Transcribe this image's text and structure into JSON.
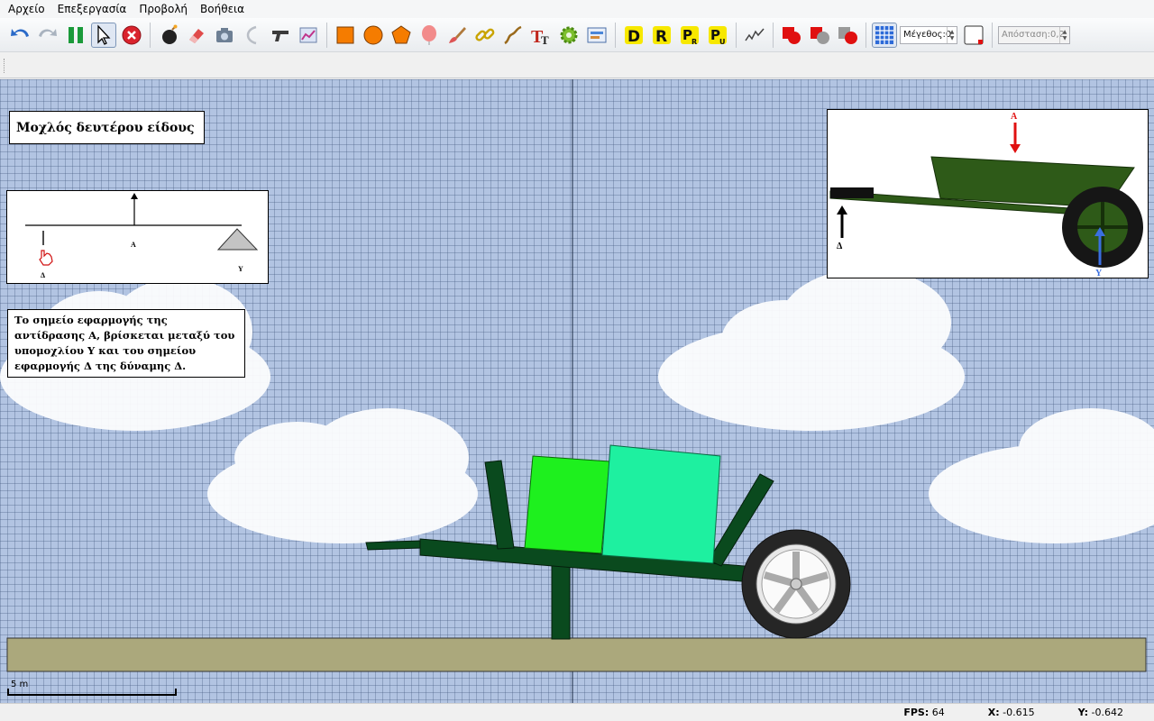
{
  "menu": [
    "Αρχείο",
    "Επεξεργασία",
    "Προβολή",
    "Βοήθεια"
  ],
  "toolbar": {
    "size_field": "Μέγεθος:0",
    "distance_field": "Απόσταση:0,2"
  },
  "icons": {
    "undo": "undo-icon",
    "redo": "redo-icon",
    "pause": "pause-icon",
    "pointer": "pointer-icon",
    "delete": "delete-icon",
    "bomb": "bomb-icon",
    "eraser": "eraser-icon",
    "camera": "camera-icon",
    "rope": "rope-icon",
    "gun": "gun-icon",
    "graph": "graph-icon",
    "box": "box-icon",
    "circle": "circle-icon",
    "polygon": "polygon-icon",
    "balloon": "balloon-icon",
    "brush": "brush-icon",
    "chain": "chain-icon",
    "spring": "spring-icon",
    "text": "text-icon",
    "gear": "gear-icon",
    "image": "image-icon",
    "joint_d": "joint-d-icon",
    "joint_r": "joint-r-icon",
    "joint_pr": "joint-pr-icon",
    "joint_pu": "joint-pu-icon",
    "zigzag": "zigzag-icon",
    "collide_a": "collide-a-icon",
    "collide_b": "collide-b-icon",
    "collide_c": "collide-c-icon",
    "grid": "grid-icon",
    "color": "color-swatch-icon"
  },
  "scene": {
    "title": "Μοχλός δευτέρου είδους",
    "note": "Το σημείο εφαρμογής της αντίδρασης Α, βρίσκεται μεταξύ του υπομοχλίου Υ και του σημείου εφαρμογής Δ της δύναμης Δ.",
    "lever_labels": {
      "delta": "Δ",
      "alpha": "Α",
      "ypsilon": "Υ"
    },
    "photo_labels": {
      "alpha": "Α",
      "delta": "Δ",
      "ypsilon": "Υ"
    },
    "scale_label": "5 m",
    "colors": {
      "frame": "#0a4a1e",
      "box_a": "#1ef01e",
      "box_b": "#1ef0a0",
      "ground": "#aba87c",
      "sky": "#b2c4e2"
    }
  },
  "status": {
    "fps_label": "FPS:",
    "fps_value": "64",
    "x_label": "X:",
    "x_value": "-0.615",
    "y_label": "Y:",
    "y_value": "-0.642"
  }
}
